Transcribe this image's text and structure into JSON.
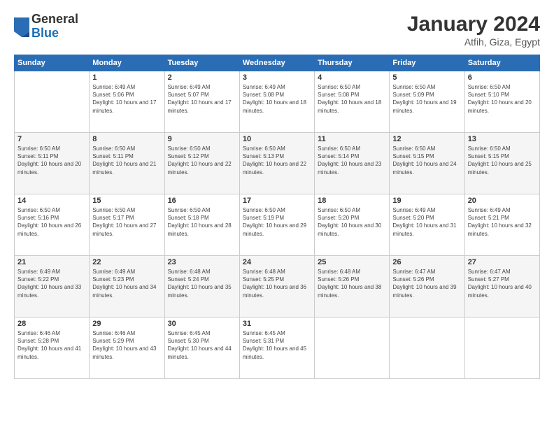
{
  "header": {
    "logo": {
      "general": "General",
      "blue": "Blue"
    },
    "title": "January 2024",
    "location": "Atfih, Giza, Egypt"
  },
  "weekdays": [
    "Sunday",
    "Monday",
    "Tuesday",
    "Wednesday",
    "Thursday",
    "Friday",
    "Saturday"
  ],
  "weeks": [
    [
      {
        "day": "",
        "sunrise": "",
        "sunset": "",
        "daylight": ""
      },
      {
        "day": "1",
        "sunrise": "Sunrise: 6:49 AM",
        "sunset": "Sunset: 5:06 PM",
        "daylight": "Daylight: 10 hours and 17 minutes."
      },
      {
        "day": "2",
        "sunrise": "Sunrise: 6:49 AM",
        "sunset": "Sunset: 5:07 PM",
        "daylight": "Daylight: 10 hours and 17 minutes."
      },
      {
        "day": "3",
        "sunrise": "Sunrise: 6:49 AM",
        "sunset": "Sunset: 5:08 PM",
        "daylight": "Daylight: 10 hours and 18 minutes."
      },
      {
        "day": "4",
        "sunrise": "Sunrise: 6:50 AM",
        "sunset": "Sunset: 5:08 PM",
        "daylight": "Daylight: 10 hours and 18 minutes."
      },
      {
        "day": "5",
        "sunrise": "Sunrise: 6:50 AM",
        "sunset": "Sunset: 5:09 PM",
        "daylight": "Daylight: 10 hours and 19 minutes."
      },
      {
        "day": "6",
        "sunrise": "Sunrise: 6:50 AM",
        "sunset": "Sunset: 5:10 PM",
        "daylight": "Daylight: 10 hours and 20 minutes."
      }
    ],
    [
      {
        "day": "7",
        "sunrise": "Sunrise: 6:50 AM",
        "sunset": "Sunset: 5:11 PM",
        "daylight": "Daylight: 10 hours and 20 minutes."
      },
      {
        "day": "8",
        "sunrise": "Sunrise: 6:50 AM",
        "sunset": "Sunset: 5:11 PM",
        "daylight": "Daylight: 10 hours and 21 minutes."
      },
      {
        "day": "9",
        "sunrise": "Sunrise: 6:50 AM",
        "sunset": "Sunset: 5:12 PM",
        "daylight": "Daylight: 10 hours and 22 minutes."
      },
      {
        "day": "10",
        "sunrise": "Sunrise: 6:50 AM",
        "sunset": "Sunset: 5:13 PM",
        "daylight": "Daylight: 10 hours and 22 minutes."
      },
      {
        "day": "11",
        "sunrise": "Sunrise: 6:50 AM",
        "sunset": "Sunset: 5:14 PM",
        "daylight": "Daylight: 10 hours and 23 minutes."
      },
      {
        "day": "12",
        "sunrise": "Sunrise: 6:50 AM",
        "sunset": "Sunset: 5:15 PM",
        "daylight": "Daylight: 10 hours and 24 minutes."
      },
      {
        "day": "13",
        "sunrise": "Sunrise: 6:50 AM",
        "sunset": "Sunset: 5:15 PM",
        "daylight": "Daylight: 10 hours and 25 minutes."
      }
    ],
    [
      {
        "day": "14",
        "sunrise": "Sunrise: 6:50 AM",
        "sunset": "Sunset: 5:16 PM",
        "daylight": "Daylight: 10 hours and 26 minutes."
      },
      {
        "day": "15",
        "sunrise": "Sunrise: 6:50 AM",
        "sunset": "Sunset: 5:17 PM",
        "daylight": "Daylight: 10 hours and 27 minutes."
      },
      {
        "day": "16",
        "sunrise": "Sunrise: 6:50 AM",
        "sunset": "Sunset: 5:18 PM",
        "daylight": "Daylight: 10 hours and 28 minutes."
      },
      {
        "day": "17",
        "sunrise": "Sunrise: 6:50 AM",
        "sunset": "Sunset: 5:19 PM",
        "daylight": "Daylight: 10 hours and 29 minutes."
      },
      {
        "day": "18",
        "sunrise": "Sunrise: 6:50 AM",
        "sunset": "Sunset: 5:20 PM",
        "daylight": "Daylight: 10 hours and 30 minutes."
      },
      {
        "day": "19",
        "sunrise": "Sunrise: 6:49 AM",
        "sunset": "Sunset: 5:20 PM",
        "daylight": "Daylight: 10 hours and 31 minutes."
      },
      {
        "day": "20",
        "sunrise": "Sunrise: 6:49 AM",
        "sunset": "Sunset: 5:21 PM",
        "daylight": "Daylight: 10 hours and 32 minutes."
      }
    ],
    [
      {
        "day": "21",
        "sunrise": "Sunrise: 6:49 AM",
        "sunset": "Sunset: 5:22 PM",
        "daylight": "Daylight: 10 hours and 33 minutes."
      },
      {
        "day": "22",
        "sunrise": "Sunrise: 6:49 AM",
        "sunset": "Sunset: 5:23 PM",
        "daylight": "Daylight: 10 hours and 34 minutes."
      },
      {
        "day": "23",
        "sunrise": "Sunrise: 6:48 AM",
        "sunset": "Sunset: 5:24 PM",
        "daylight": "Daylight: 10 hours and 35 minutes."
      },
      {
        "day": "24",
        "sunrise": "Sunrise: 6:48 AM",
        "sunset": "Sunset: 5:25 PM",
        "daylight": "Daylight: 10 hours and 36 minutes."
      },
      {
        "day": "25",
        "sunrise": "Sunrise: 6:48 AM",
        "sunset": "Sunset: 5:26 PM",
        "daylight": "Daylight: 10 hours and 38 minutes."
      },
      {
        "day": "26",
        "sunrise": "Sunrise: 6:47 AM",
        "sunset": "Sunset: 5:26 PM",
        "daylight": "Daylight: 10 hours and 39 minutes."
      },
      {
        "day": "27",
        "sunrise": "Sunrise: 6:47 AM",
        "sunset": "Sunset: 5:27 PM",
        "daylight": "Daylight: 10 hours and 40 minutes."
      }
    ],
    [
      {
        "day": "28",
        "sunrise": "Sunrise: 6:46 AM",
        "sunset": "Sunset: 5:28 PM",
        "daylight": "Daylight: 10 hours and 41 minutes."
      },
      {
        "day": "29",
        "sunrise": "Sunrise: 6:46 AM",
        "sunset": "Sunset: 5:29 PM",
        "daylight": "Daylight: 10 hours and 43 minutes."
      },
      {
        "day": "30",
        "sunrise": "Sunrise: 6:45 AM",
        "sunset": "Sunset: 5:30 PM",
        "daylight": "Daylight: 10 hours and 44 minutes."
      },
      {
        "day": "31",
        "sunrise": "Sunrise: 6:45 AM",
        "sunset": "Sunset: 5:31 PM",
        "daylight": "Daylight: 10 hours and 45 minutes."
      },
      {
        "day": "",
        "sunrise": "",
        "sunset": "",
        "daylight": ""
      },
      {
        "day": "",
        "sunrise": "",
        "sunset": "",
        "daylight": ""
      },
      {
        "day": "",
        "sunrise": "",
        "sunset": "",
        "daylight": ""
      }
    ]
  ]
}
